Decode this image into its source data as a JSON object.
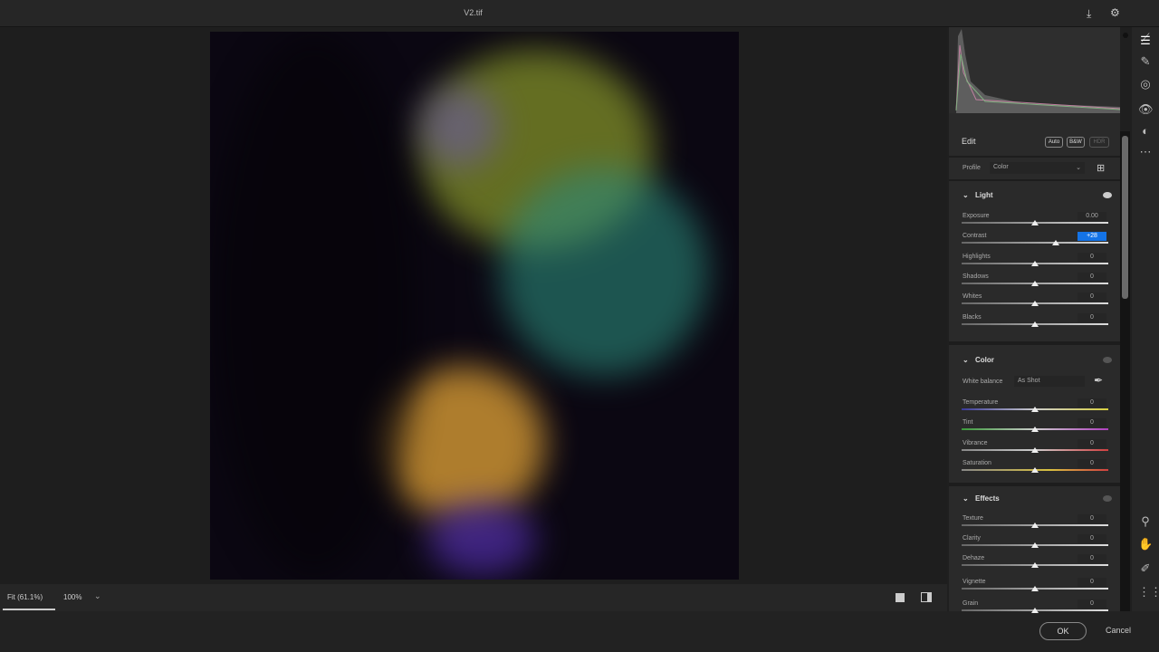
{
  "title": "V2.tif",
  "edit": {
    "title": "Edit",
    "auto": "Auto",
    "bw": "B&W",
    "hdr": "HDR",
    "profile_label": "Profile",
    "profile_value": "Color"
  },
  "light": {
    "title": "Light",
    "sliders": [
      {
        "label": "Exposure",
        "value": "0.00",
        "pos": 0.5
      },
      {
        "label": "Contrast",
        "value": "+28",
        "pos": 0.64,
        "active": true
      },
      {
        "label": "Highlights",
        "value": "0",
        "pos": 0.5
      },
      {
        "label": "Shadows",
        "value": "0",
        "pos": 0.5
      },
      {
        "label": "Whites",
        "value": "0",
        "pos": 0.5
      },
      {
        "label": "Blacks",
        "value": "0",
        "pos": 0.5
      }
    ]
  },
  "color": {
    "title": "Color",
    "wb_label": "White balance",
    "wb_value": "As Shot",
    "sliders": [
      {
        "label": "Temperature",
        "value": "0",
        "pos": 0.5,
        "grad": "linear-gradient(90deg,#3a3a9a,#ccc 50%,#d8d040)"
      },
      {
        "label": "Tint",
        "value": "0",
        "pos": 0.5,
        "grad": "linear-gradient(90deg,#3a9a3a,#ccc 50%,#b040c0)"
      },
      {
        "label": "Vibrance",
        "value": "0",
        "pos": 0.5,
        "grad": "linear-gradient(90deg,#888,#ccc 50%,#d04040)"
      },
      {
        "label": "Saturation",
        "value": "0",
        "pos": 0.5,
        "grad": "linear-gradient(90deg,#888,#d8c040 60%,#d04040)"
      }
    ]
  },
  "effects": {
    "title": "Effects",
    "sliders": [
      {
        "label": "Texture",
        "value": "0",
        "pos": 0.5
      },
      {
        "label": "Clarity",
        "value": "0",
        "pos": 0.5
      },
      {
        "label": "Dehaze",
        "value": "0",
        "pos": 0.5
      },
      {
        "label": "Vignette",
        "value": "0",
        "pos": 0.5
      },
      {
        "label": "Grain",
        "value": "0",
        "pos": 0.5
      }
    ]
  },
  "bottom": {
    "fit": "Fit (61.1%)",
    "zoom": "100%"
  },
  "footer": {
    "ok": "OK",
    "cancel": "Cancel"
  }
}
